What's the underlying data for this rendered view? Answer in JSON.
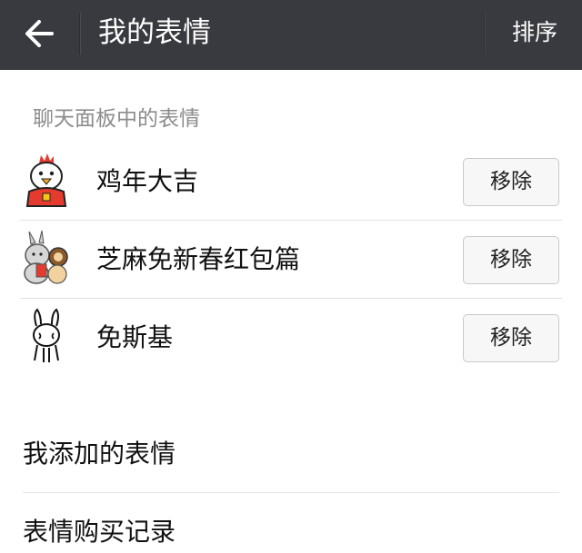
{
  "header": {
    "title": "我的表情",
    "sort_label": "排序",
    "background": "#393a3f"
  },
  "chat_panel": {
    "section_label": "聊天面板中的表情",
    "packs": [
      {
        "name": "鸡年大吉",
        "icon": "rooster-sticker-icon",
        "remove_label": "移除"
      },
      {
        "name": "芝麻免新春红包篇",
        "icon": "bunny-redpacket-sticker-icon",
        "remove_label": "移除"
      },
      {
        "name": "免斯基",
        "icon": "tuzki-sticker-icon",
        "remove_label": "移除"
      }
    ]
  },
  "menu": {
    "added_stickers": "我添加的表情",
    "purchase_history": "表情购买记录"
  }
}
